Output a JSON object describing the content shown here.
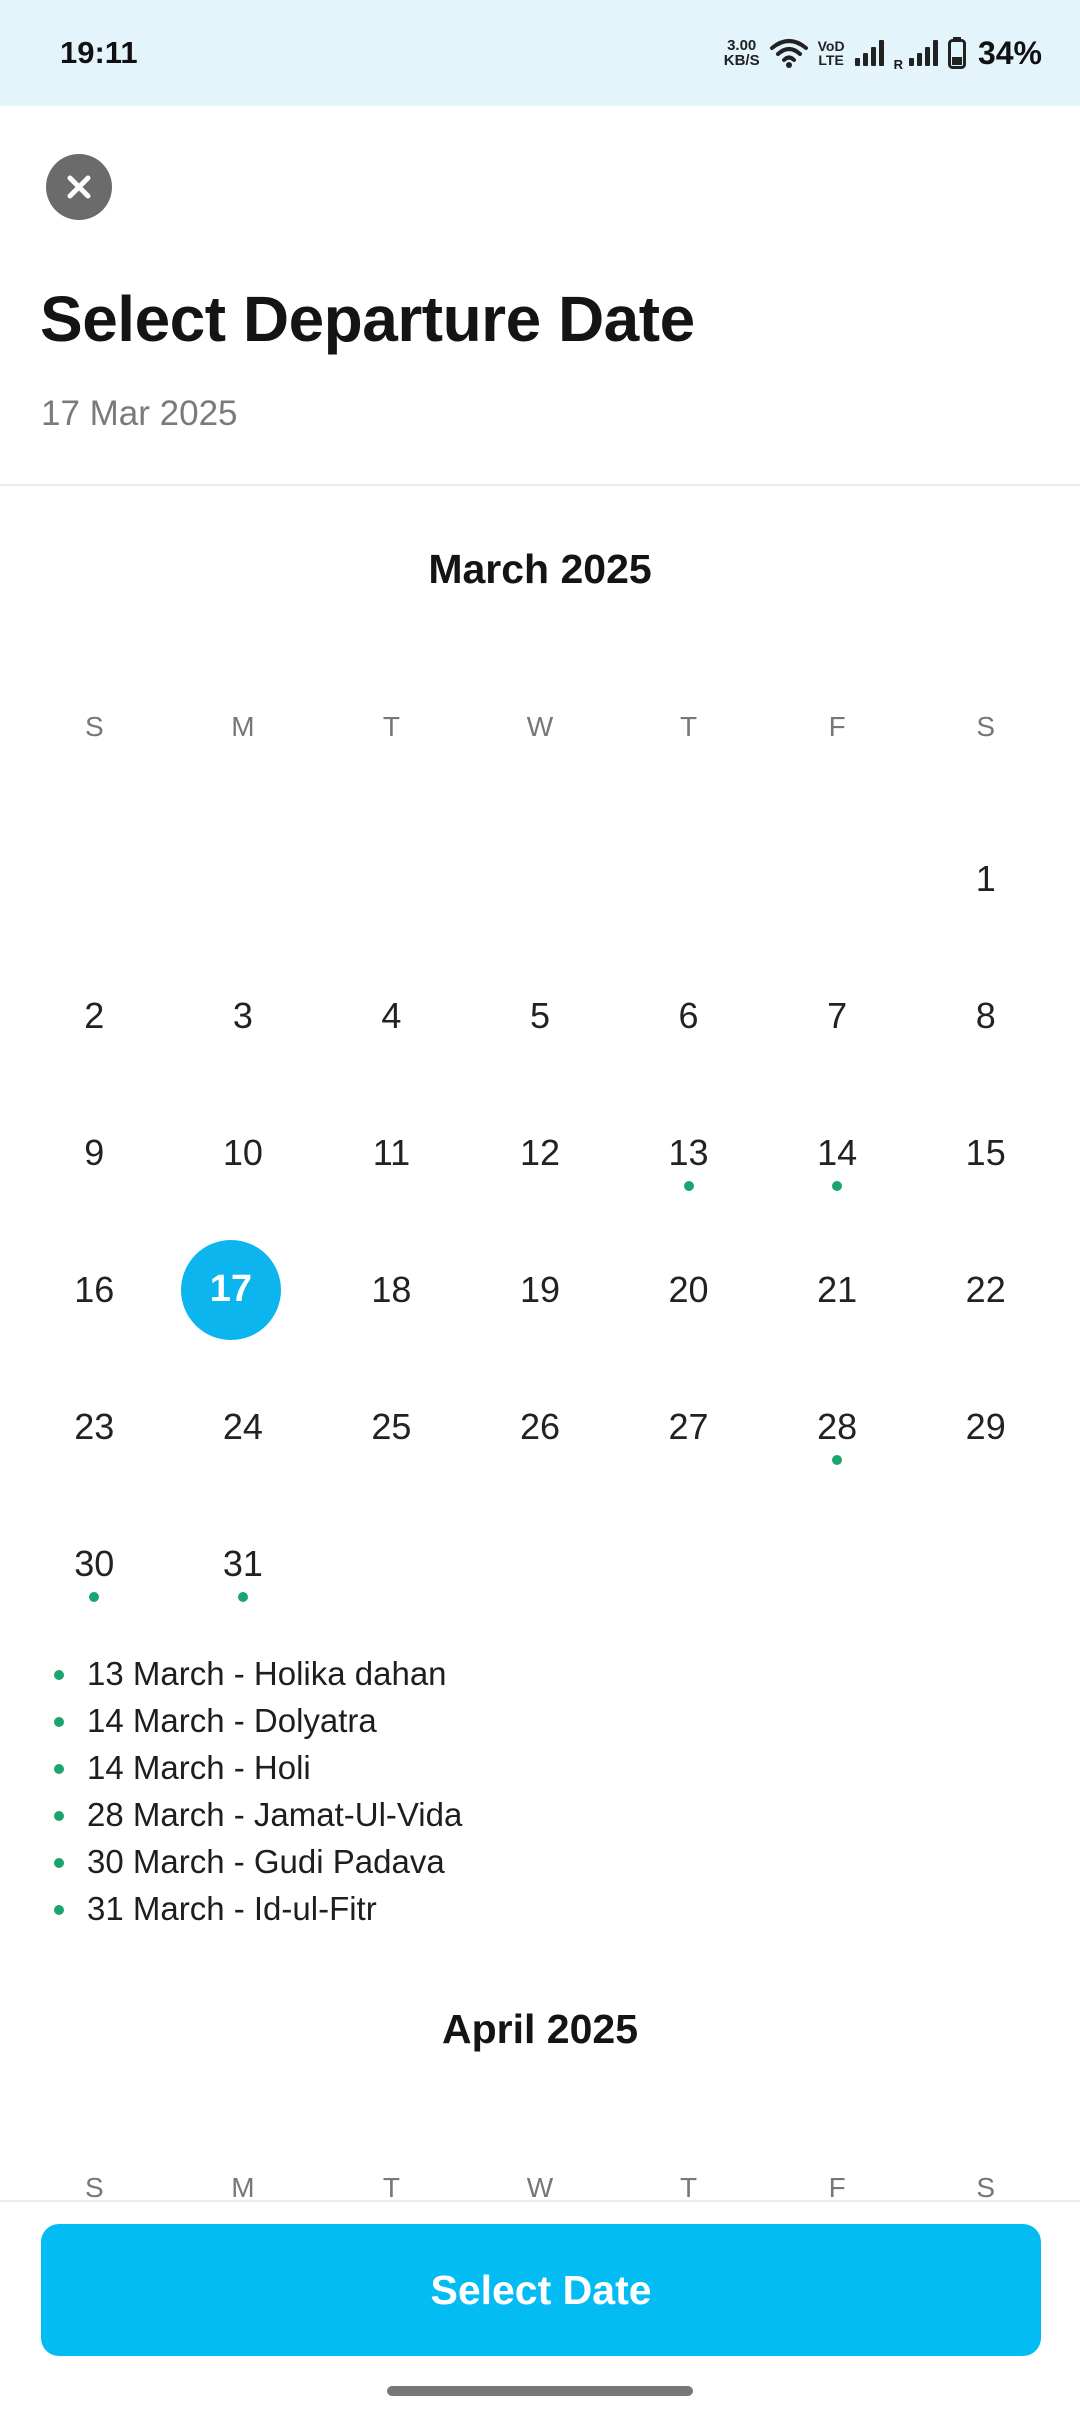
{
  "status_bar": {
    "time": "19:11",
    "net_speed_value": "3.00",
    "net_speed_unit": "KB/S",
    "volte_top": "VoD",
    "volte_bottom": "LTE",
    "roaming_label": "R",
    "battery": "34%"
  },
  "header": {
    "title": "Select Departure Date",
    "selected_date": "17 Mar 2025"
  },
  "calendar": {
    "weekdays": [
      "S",
      "M",
      "T",
      "W",
      "T",
      "F",
      "S"
    ],
    "march": {
      "title": "March 2025",
      "rows": [
        [
          "",
          "",
          "",
          "",
          "",
          "",
          "1"
        ],
        [
          "2",
          "3",
          "4",
          "5",
          "6",
          "7",
          "8"
        ],
        [
          "9",
          "10",
          "11",
          "12",
          "13",
          "14",
          "15"
        ],
        [
          "16",
          "17",
          "18",
          "19",
          "20",
          "21",
          "22"
        ],
        [
          "23",
          "24",
          "25",
          "26",
          "27",
          "28",
          "29"
        ],
        [
          "30",
          "31",
          "",
          "",
          "",
          "",
          ""
        ]
      ],
      "selected_day": "17",
      "holiday_days": [
        "13",
        "14",
        "28",
        "30",
        "31"
      ],
      "holidays": [
        "13 March - Holika dahan",
        "14 March - Dolyatra",
        "14 March - Holi",
        "28 March - Jamat-Ul-Vida",
        "30 March - Gudi Padava",
        "31 March - Id-ul-Fitr"
      ]
    },
    "april": {
      "title": "April 2025"
    }
  },
  "footer": {
    "select_button": "Select Date"
  },
  "colors": {
    "accent": "#03bcf4",
    "holiday_dot": "#1aa56f",
    "status_bar_bg": "#e3f4fb"
  }
}
